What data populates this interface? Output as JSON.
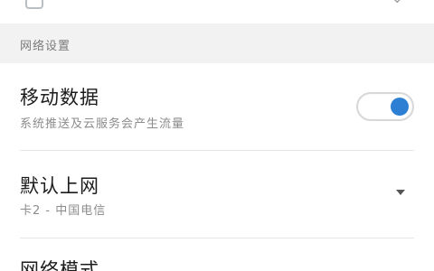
{
  "top_row": {
    "label": ""
  },
  "section": {
    "title": "网络设置"
  },
  "mobile_data": {
    "title": "移动数据",
    "subtitle": "系统推送及云服务会产生流量",
    "enabled": true,
    "accent_color": "#2d7fd3"
  },
  "default_internet": {
    "title": "默认上网",
    "subtitle": "卡2 - 中国电信"
  },
  "network_mode": {
    "title": "网络模式"
  }
}
